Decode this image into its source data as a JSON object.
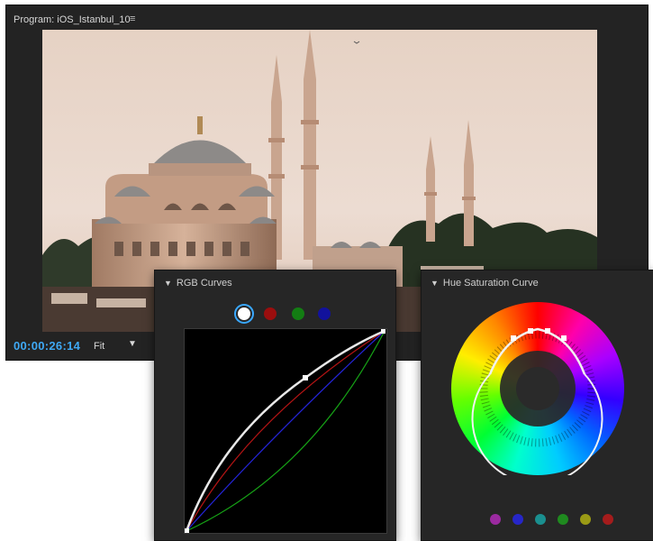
{
  "program_monitor": {
    "title": "Program: iOS_Istanbul_10",
    "menu_icon": "≡",
    "timecode": "00:00:26:14",
    "zoom": "Fit",
    "zoom_caret": "▼"
  },
  "rgb_curves": {
    "title": "RGB Curves",
    "collapse_icon": "▼",
    "channels": [
      {
        "name": "master",
        "color": "#ffffff",
        "selected": true
      },
      {
        "name": "red",
        "color": "#9b0e0e",
        "selected": false
      },
      {
        "name": "green",
        "color": "#137d13",
        "selected": false
      },
      {
        "name": "blue",
        "color": "#12129c",
        "selected": false
      }
    ]
  },
  "hue_saturation_curve": {
    "title": "Hue Saturation Curve",
    "collapse_icon": "▼",
    "color_dots": [
      "#9b2aa0",
      "#2626c8",
      "#1a8f8f",
      "#1f8a1f",
      "#9a9a15",
      "#a51c1c"
    ]
  }
}
